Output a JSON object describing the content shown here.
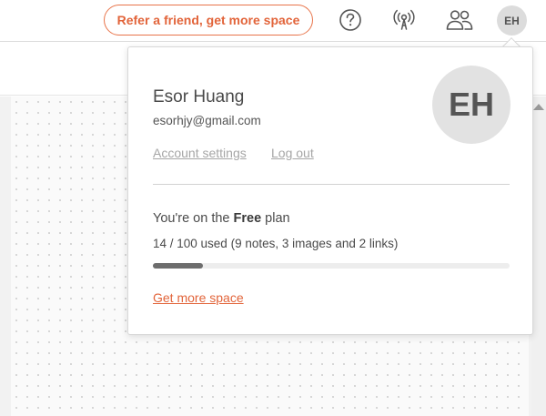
{
  "header": {
    "refer_label": "Refer a friend, get more space",
    "icons": [
      "help-icon",
      "broadcast-icon",
      "people-icon"
    ],
    "avatar_initials": "EH"
  },
  "account_popover": {
    "user_name": "Esor Huang",
    "user_email": "esorhjy@gmail.com",
    "avatar_initials": "EH",
    "account_settings_label": "Account settings",
    "logout_label": "Log out",
    "plan_prefix": "You're on the ",
    "plan_name": "Free",
    "plan_suffix": " plan",
    "usage_text": "14 / 100 used (9 notes, 3 images and 2 links)",
    "usage_fraction": 0.14,
    "get_more_space_label": "Get more space"
  },
  "colors": {
    "accent": "#e2643a",
    "muted_link": "#a6a6a6",
    "progress_fill": "#6d6d6d",
    "progress_track": "#ededed"
  }
}
